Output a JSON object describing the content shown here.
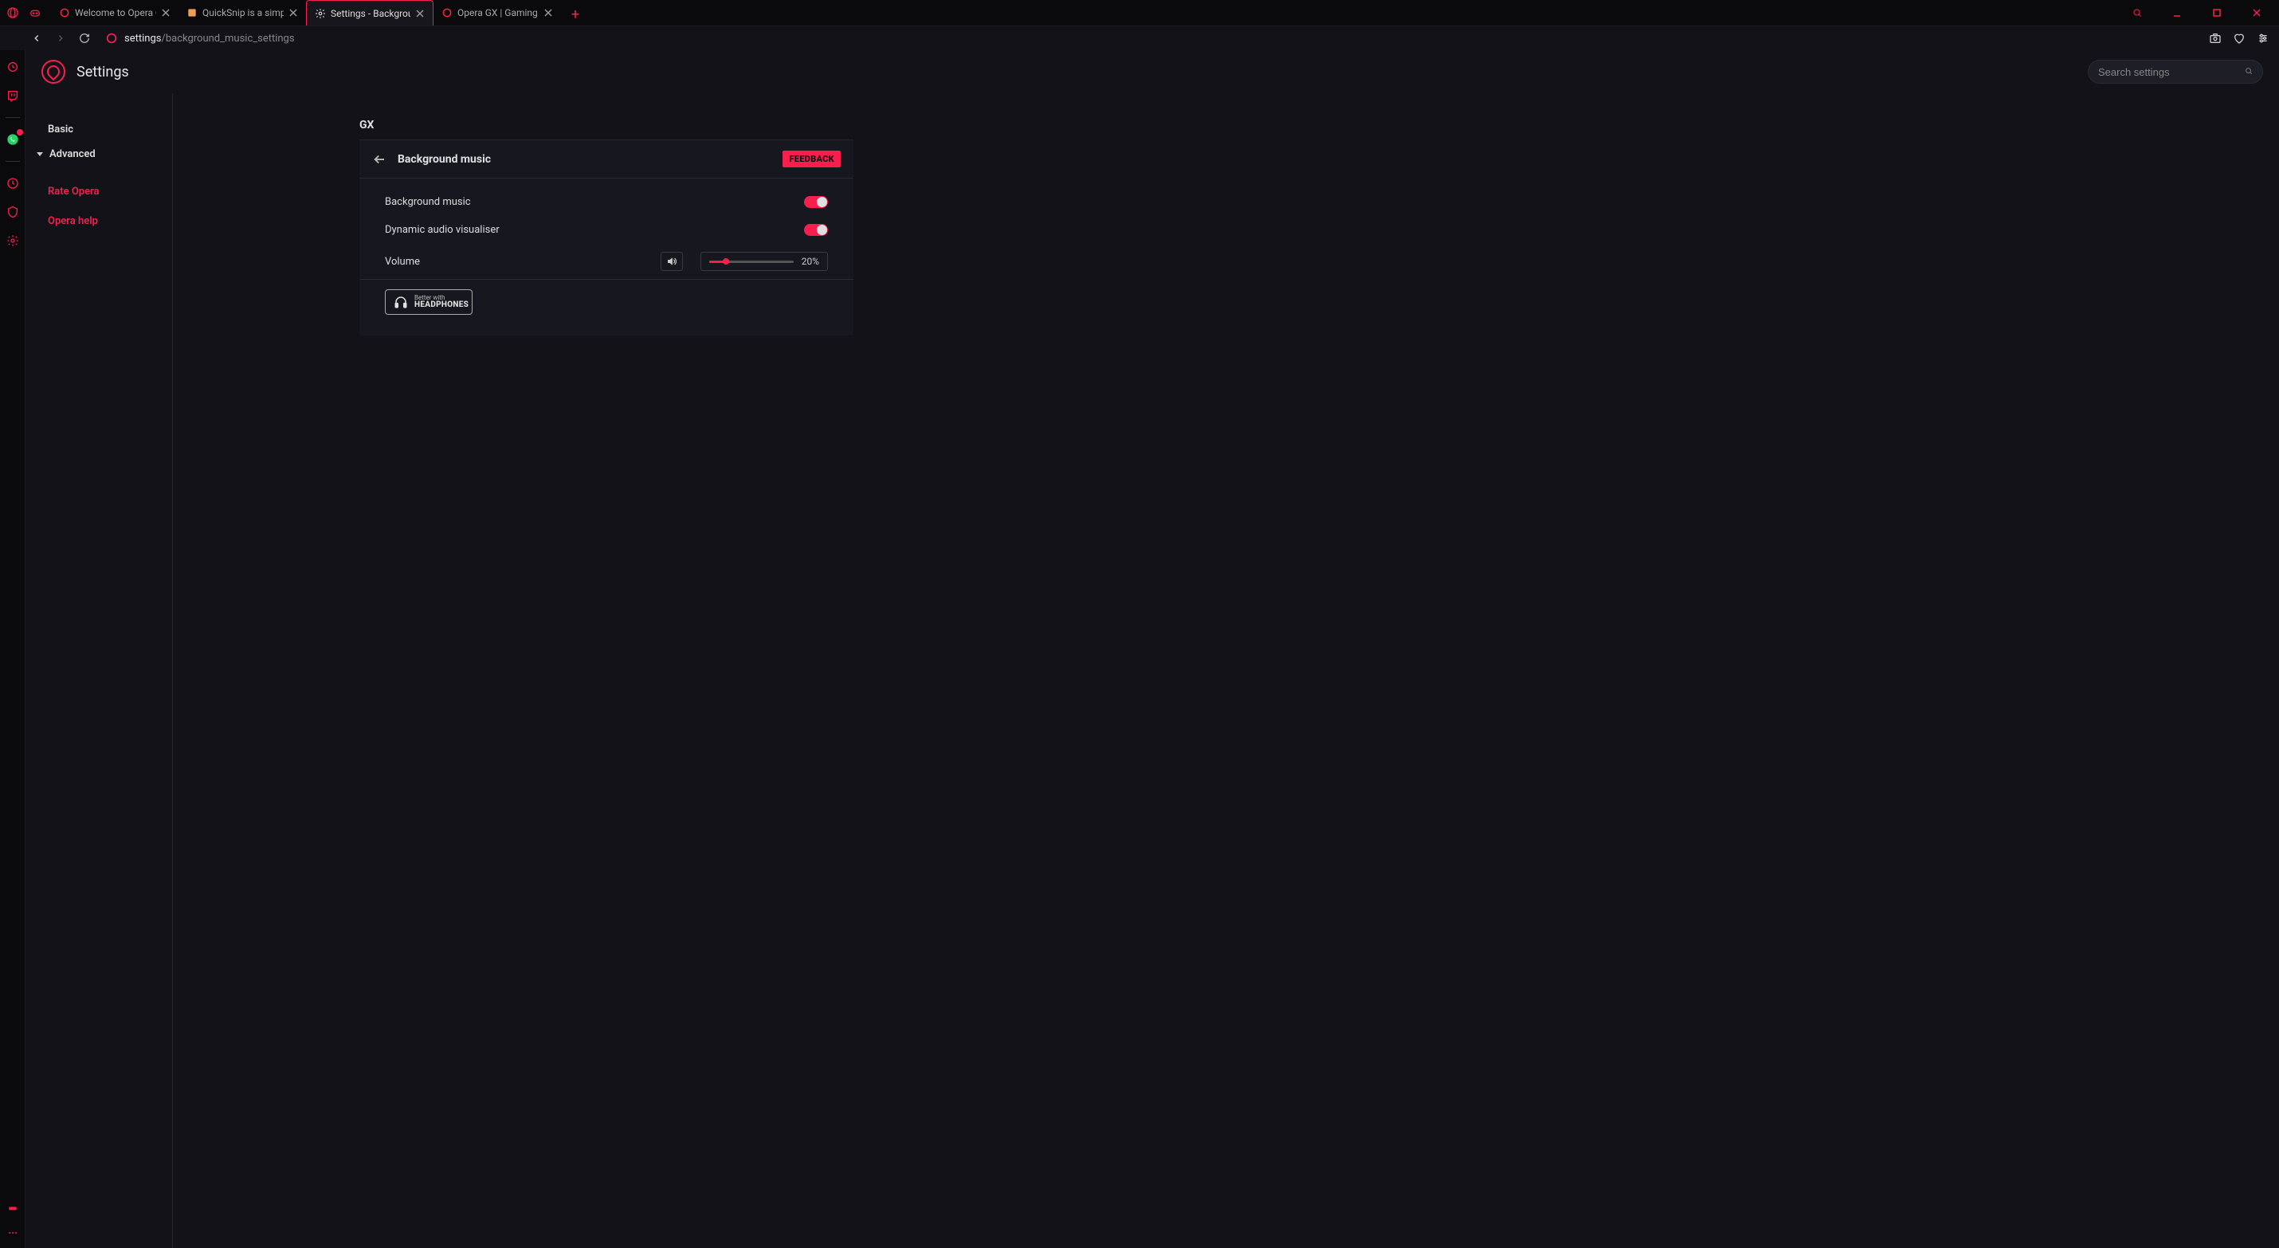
{
  "titlebar": {
    "tabs": [
      {
        "title": "Welcome to Opera GX!",
        "icon": "opera-red"
      },
      {
        "title": "QuickSnip is a simple scree",
        "icon": "orange"
      },
      {
        "title": "Settings - Background musi",
        "icon": "gear",
        "active": true
      },
      {
        "title": "Opera GX | Gaming Browse",
        "icon": "opera-red"
      }
    ]
  },
  "addressbar": {
    "url_prefix": "settings",
    "url_rest": "/background_music_settings"
  },
  "page": {
    "title": "Settings",
    "search_placeholder": "Search settings"
  },
  "sidebar": {
    "basic": "Basic",
    "advanced": "Advanced",
    "rate": "Rate Opera",
    "help": "Opera help"
  },
  "settings": {
    "section_label": "GX",
    "card_title": "Background music",
    "feedback": "FEEDBACK",
    "rows": {
      "bg_music": "Background music",
      "visualiser": "Dynamic audio visualiser",
      "volume": "Volume",
      "volume_pct": "20%"
    },
    "headphones": {
      "small": "Better with",
      "big": "HEADPHONES"
    }
  }
}
